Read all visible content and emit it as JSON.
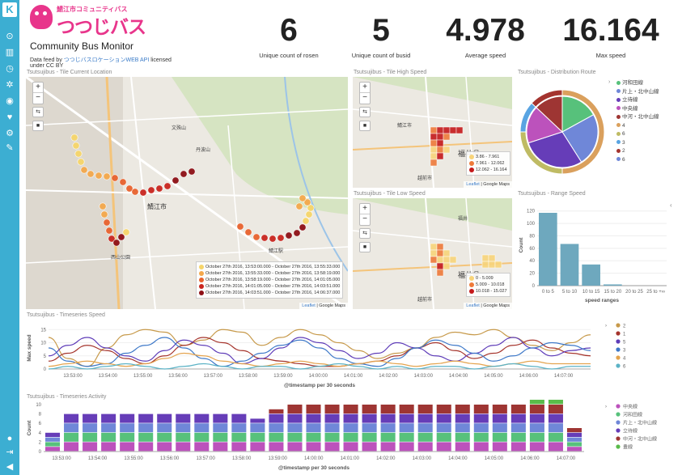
{
  "sidebar": {
    "logo": "K"
  },
  "header": {
    "logo_small": "鯖江市コミュニティバス",
    "logo_big": "つつじバス",
    "title": "Community Bus Monitor",
    "feed_prefix": "Data feed by ",
    "feed_link": "つつじバスロケーションWEB API",
    "feed_suffix": " licensed",
    "feed_line2": "under CC BY"
  },
  "metrics": [
    {
      "value": "6",
      "label": "Unique count of rosen"
    },
    {
      "value": "5",
      "label": "Unique count of busid"
    },
    {
      "value": "4.978",
      "label": "Average speed"
    },
    {
      "value": "16.164",
      "label": "Max speed"
    }
  ],
  "panels": {
    "current": "Tsutsujibus - Tile Current Location",
    "high": "Tsutsujibus - Tile High Speed",
    "low": "Tsutsujibus - Tile Low Speed",
    "dist": "Tsutsujibus - Distribution Route",
    "range": "Tsutsujibus - Range Speed",
    "timeseries": "Tsutsujibus - Timeseries Speed",
    "activity": "Tsutsujibus - Timeseries Activity"
  },
  "maps": {
    "attr_leaflet": "Leaflet",
    "attr_sep": " | Google Maps",
    "current_legend": [
      {
        "text": "October 27th 2016, 13:53:00.000 - October 27th 2016, 13:55:33.000",
        "color": "#f6d56a"
      },
      {
        "text": "October 27th 2016, 13:55:33.000 - October 27th 2016, 13:58:19.000",
        "color": "#f4a84c"
      },
      {
        "text": "October 27th 2016, 13:58:19.000 - October 27th 2016, 14:01:05.000",
        "color": "#e8632e"
      },
      {
        "text": "October 27th 2016, 14:01:05.000 - October 27th 2016, 14:03:51.000",
        "color": "#c9261f"
      },
      {
        "text": "October 27th 2016, 14:03:51.000 - October 27th 2016, 14:06:37.000",
        "color": "#8e1016"
      }
    ],
    "high_legend": [
      {
        "text": "3.86 - 7.961",
        "color": "#f8d47a"
      },
      {
        "text": "7.961 - 12.062",
        "color": "#ee7a3a"
      },
      {
        "text": "12.062 - 16.164",
        "color": "#c5191b"
      }
    ],
    "low_legend": [
      {
        "text": "0 - 5.009",
        "color": "#f8d47a"
      },
      {
        "text": "5.009 - 10.018",
        "color": "#ee7a3a"
      },
      {
        "text": "10.018 - 15.027",
        "color": "#c5191b"
      }
    ],
    "labels": {
      "sabae": "鯖江市",
      "fukui": "福井県",
      "echizen": "越前市",
      "sabae2": "鯖江市",
      "echizen2": "越前市",
      "fukui2": "福井県",
      "fukui3": "福井",
      "sabae_yoko": "鯖江",
      "station": "鯖江駅",
      "westage": "西山公園",
      "pole": "丹波山",
      "bunka": "文殊山"
    }
  },
  "chart_data": [
    {
      "type": "pie",
      "title": "Tsutsujibus - Distribution Route",
      "legend": [
        "河和田線",
        "片上・北中山線",
        "立待線",
        "中央線",
        "中河・北中山線",
        "4",
        "6",
        "3",
        "2",
        "6"
      ],
      "legend_colors": [
        "#57c17b",
        "#6f87d8",
        "#663db8",
        "#bc52bc",
        "#9e3533",
        "#daa05d",
        "#bfbb64",
        "#59a4e2",
        "#a4342f",
        "#6f87d8"
      ],
      "inner": [
        {
          "name": "河和田線",
          "value": 17
        },
        {
          "name": "片上・北中山線",
          "value": 24
        },
        {
          "name": "立待線",
          "value": 29
        },
        {
          "name": "中央線",
          "value": 17
        },
        {
          "name": "中河・北中山線",
          "value": 13
        }
      ],
      "outer": [
        {
          "name": "4",
          "value": 50
        },
        {
          "name": "6",
          "value": 25
        },
        {
          "name": "3",
          "value": 12
        },
        {
          "name": "2",
          "value": 13
        }
      ]
    },
    {
      "type": "bar",
      "title": "Tsutsujibus - Range Speed",
      "categories": [
        "0 to 5",
        "5 to 10",
        "10 to 15",
        "15 to 20",
        "20 to 25",
        "25 to +∞"
      ],
      "values": [
        117,
        67,
        34,
        2,
        0,
        0
      ],
      "ylabel": "Count",
      "xlabel": "speed ranges",
      "ylim": [
        0,
        130
      ],
      "yticks": [
        "0",
        "20",
        "40",
        "60",
        "80",
        "100",
        "120"
      ],
      "color": "#6ea8be"
    },
    {
      "type": "line",
      "title": "Tsutsujibus - Timeseries Speed",
      "ylabel": "Max speed",
      "xlabel": "@timestamp per 30 seconds",
      "yticks": [
        "0",
        "5",
        "10",
        "15"
      ],
      "ylim": [
        0,
        16
      ],
      "xticks": [
        "13:53:00",
        "13:54:00",
        "13:55:00",
        "13:56:00",
        "13:57:00",
        "13:58:00",
        "13:59:00",
        "14:00:00",
        "14:01:00",
        "14:02:00",
        "14:03:00",
        "14:04:00",
        "14:05:00",
        "14:06:00",
        "14:07:00"
      ],
      "series": [
        {
          "name": "2",
          "color": "#c79a4b",
          "values": [
            12,
            4,
            1,
            8,
            13,
            15,
            14,
            9,
            11,
            15,
            14,
            9,
            12,
            15,
            13,
            10,
            7,
            4,
            6,
            8,
            12,
            14,
            13,
            15,
            12,
            9,
            7,
            10,
            13
          ]
        },
        {
          "name": "1",
          "color": "#a5342c",
          "values": [
            3,
            6,
            9,
            7,
            4,
            2,
            5,
            9,
            12,
            10,
            7,
            4,
            3,
            2,
            1,
            1,
            2,
            3,
            5,
            8,
            10,
            7,
            4,
            6,
            9,
            11,
            8,
            6,
            5
          ]
        },
        {
          "name": "5",
          "color": "#5e3cb8",
          "values": [
            5,
            9,
            12,
            8,
            5,
            3,
            7,
            11,
            9,
            6,
            2,
            4,
            8,
            12,
            10,
            7,
            4,
            6,
            10,
            8,
            5,
            3,
            6,
            9,
            12,
            8,
            5,
            7,
            8
          ]
        },
        {
          "name": "3",
          "color": "#3d78c8",
          "values": [
            8,
            3,
            1,
            2,
            6,
            9,
            12,
            8,
            4,
            1,
            3,
            6,
            9,
            11,
            8,
            4,
            2,
            1,
            4,
            8,
            11,
            9,
            6,
            3,
            5,
            8,
            10,
            9,
            7
          ]
        },
        {
          "name": "4",
          "color": "#e4a44f",
          "values": [
            1,
            2,
            3,
            2,
            1,
            2,
            4,
            6,
            5,
            3,
            2,
            1,
            2,
            3,
            2,
            1,
            2,
            3,
            2,
            1,
            2,
            3,
            2,
            1,
            2,
            3,
            2,
            2,
            2
          ]
        },
        {
          "name": "6",
          "color": "#5cb3c6",
          "values": [
            0,
            1,
            0,
            1,
            2,
            1,
            0,
            1,
            2,
            1,
            0,
            1,
            1,
            0,
            1,
            2,
            1,
            0,
            1,
            0,
            1,
            1,
            0,
            1,
            2,
            1,
            0,
            1,
            1
          ]
        }
      ]
    },
    {
      "type": "bar",
      "stacked": true,
      "title": "Tsutsujibus - Timeseries Activity",
      "ylabel": "Count",
      "xlabel": "@timestamp per 30 seconds",
      "yticks": [
        "0",
        "2",
        "4",
        "6",
        "8",
        "10"
      ],
      "ylim": [
        0,
        10
      ],
      "xticks": [
        "13:53:00",
        "13:54:00",
        "13:55:00",
        "13:56:00",
        "13:57:00",
        "13:58:00",
        "13:59:00",
        "14:00:00",
        "14:01:00",
        "14:02:00",
        "14:03:00",
        "14:04:00",
        "14:05:00",
        "14:06:00",
        "14:07:00"
      ],
      "series": [
        {
          "name": "中央線",
          "color": "#bc52bc",
          "values": [
            1,
            2,
            2,
            2,
            2,
            2,
            2,
            2,
            2,
            2,
            2,
            2,
            2,
            2,
            2,
            2,
            2,
            2,
            2,
            2,
            2,
            2,
            2,
            2,
            2,
            2,
            2,
            2,
            1
          ]
        },
        {
          "name": "河和田線",
          "color": "#57c17b",
          "values": [
            1,
            2,
            2,
            2,
            2,
            2,
            2,
            2,
            2,
            2,
            2,
            2,
            2,
            2,
            2,
            2,
            2,
            2,
            2,
            2,
            2,
            2,
            2,
            2,
            2,
            2,
            2,
            2,
            1
          ]
        },
        {
          "name": "片上・北中山線",
          "color": "#6f87d8",
          "values": [
            1,
            2,
            2,
            2,
            2,
            2,
            2,
            2,
            2,
            2,
            2,
            2,
            2,
            2,
            2,
            2,
            2,
            2,
            2,
            2,
            2,
            2,
            2,
            2,
            2,
            2,
            2,
            2,
            1
          ]
        },
        {
          "name": "立待線",
          "color": "#663db8",
          "values": [
            1,
            2,
            2,
            2,
            2,
            2,
            2,
            2,
            2,
            2,
            2,
            1,
            2,
            2,
            2,
            2,
            2,
            2,
            2,
            2,
            2,
            2,
            2,
            2,
            2,
            2,
            2,
            2,
            1
          ]
        },
        {
          "name": "中河・北中山線",
          "color": "#9e3533",
          "values": [
            0,
            0,
            0,
            0,
            0,
            0,
            0,
            0,
            0,
            0,
            0,
            0,
            1,
            2,
            2,
            2,
            2,
            2,
            2,
            2,
            2,
            2,
            2,
            2,
            2,
            2,
            2,
            2,
            1
          ]
        },
        {
          "name": "豊線",
          "color": "#5abb4a",
          "values": [
            0,
            0,
            0,
            0,
            0,
            0,
            0,
            0,
            0,
            0,
            0,
            0,
            0,
            0,
            0,
            0,
            0,
            0,
            0,
            0,
            0,
            0,
            0,
            0,
            0,
            0,
            2,
            2,
            0
          ]
        }
      ]
    }
  ]
}
